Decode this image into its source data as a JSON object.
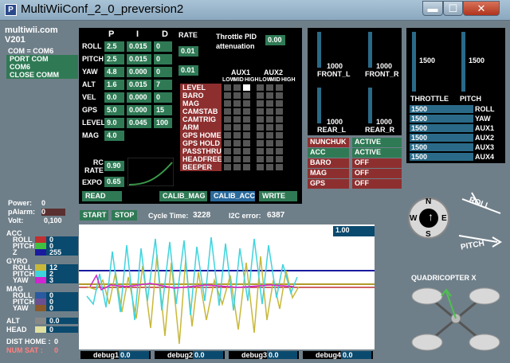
{
  "window": {
    "title": "MultiWiiConf_2_0_preversion2",
    "icon": "P",
    "min": "▬",
    "max": "☐",
    "close": "✕"
  },
  "site": "multiwii.com",
  "version": "V201",
  "com_status": "COM = COM6",
  "port": {
    "header": "PORT COM",
    "selected": "COM6",
    "close": "CLOSE COMM"
  },
  "pid": {
    "headers": {
      "p": "P",
      "i": "I",
      "d": "D",
      "rate": "RATE"
    },
    "rows": [
      {
        "name": "ROLL",
        "p": "2.5",
        "i": "0.015",
        "d": "0"
      },
      {
        "name": "PITCH",
        "p": "2.5",
        "i": "0.015",
        "d": "0"
      },
      {
        "name": "YAW",
        "p": "4.8",
        "i": "0.000",
        "d": "0"
      },
      {
        "name": "ALT",
        "p": "1.6",
        "i": "0.015",
        "d": "7"
      },
      {
        "name": "VEL",
        "p": "0.0",
        "i": "0.000",
        "d": "0"
      },
      {
        "name": "GPS",
        "p": "5.0",
        "i": "0.000",
        "d": "15"
      },
      {
        "name": "LEVEL",
        "p": "9.0",
        "i": "0.045",
        "d": "100"
      },
      {
        "name": "MAG",
        "p": "4.0",
        "i": "",
        "d": ""
      }
    ],
    "rates": [
      "0.01",
      "0.01"
    ],
    "throttle_pid": "Throttle PID\nattenuation",
    "throttle_pid_value": "0.00",
    "rc_rate_label": "RC\nRATE",
    "rc_rate": "0.90",
    "expo_label": "EXPO",
    "expo": "0.65"
  },
  "aux": {
    "aux1": "AUX1",
    "aux2": "AUX2",
    "sub": [
      "LOW",
      "MID",
      "HIGH",
      "LOW",
      "MID",
      "HIGH"
    ],
    "modes": [
      "LEVEL",
      "BARO",
      "MAG",
      "CAMSTAB",
      "CAMTRIG",
      "ARM",
      "GPS HOME",
      "GPS HOLD",
      "PASSTHRU",
      "HEADFREE",
      "BEEPER"
    ]
  },
  "buttons": {
    "read": "READ",
    "calib_mag": "CALIB_MAG",
    "calib_acc": "CALIB_ACC",
    "write": "WRITE",
    "start": "START",
    "stop": "STOP"
  },
  "rc": {
    "front_l": "FRONT_L",
    "front_r": "FRONT_R",
    "rear_l": "REAR_L",
    "rear_r": "REAR_R",
    "front_l_val": "1000",
    "front_r_val": "1000",
    "rear_l_val": "1000",
    "rear_r_val": "1000",
    "throttle": "THROTTLE",
    "throttle_val": "1500",
    "pitch": "PITCH",
    "pitch_val": "1500",
    "channels": [
      {
        "name": "ROLL",
        "val": "1500"
      },
      {
        "name": "YAW",
        "val": "1500"
      },
      {
        "name": "AUX1",
        "val": "1500"
      },
      {
        "name": "AUX2",
        "val": "1500"
      },
      {
        "name": "AUX3",
        "val": "1500"
      },
      {
        "name": "AUX4",
        "val": "1500"
      }
    ]
  },
  "sensors": [
    {
      "name": "NUNCHUK",
      "state": "ACTIVE"
    },
    {
      "name": "ACC",
      "state": "ACTIVE"
    },
    {
      "name": "BARO",
      "state": "OFF"
    },
    {
      "name": "MAG",
      "state": "OFF"
    },
    {
      "name": "GPS",
      "state": "OFF"
    }
  ],
  "power": {
    "power_label": "Power:",
    "power": "0",
    "palarm_label": "pAlarm:",
    "palarm": "0",
    "volt_label": "Volt:",
    "volt": "0,100"
  },
  "status": {
    "cycle_label": "Cycle Time:",
    "cycle": "3228",
    "i2c_label": "I2C error:",
    "i2c": "6387"
  },
  "graph": {
    "scale": "1.00"
  },
  "left_sensors": {
    "acc": {
      "title": "ACC",
      "roll": "ROLL",
      "roll_v": "0",
      "pitch": "PITCH",
      "pitch_v": "0",
      "z": "Z",
      "z_v": "255"
    },
    "gyro": {
      "title": "GYRO",
      "roll": "ROLL",
      "roll_v": "12",
      "pitch": "PITCH",
      "pitch_v": "2",
      "yaw": "YAW",
      "yaw_v": "3"
    },
    "mag": {
      "title": "MAG",
      "roll": "ROLL",
      "roll_v": "0",
      "pitch": "PITCH",
      "pitch_v": "0",
      "yaw": "YAW",
      "yaw_v": "0"
    },
    "alt": "ALT",
    "alt_v": "0.0",
    "head": "HEAD",
    "head_v": "0",
    "dist_home": "DIST HOME : ",
    "dist_home_v": "0",
    "num_sat": "NUM SAT  : ",
    "num_sat_v": "0"
  },
  "debug": [
    {
      "label": "debug1",
      "val": "0.0"
    },
    {
      "label": "debug2",
      "val": "0.0"
    },
    {
      "label": "debug3",
      "val": "0.0"
    },
    {
      "label": "debug4",
      "val": "0.0"
    }
  ],
  "attitude": {
    "roll": "ROLL",
    "pitch": "PITCH",
    "compass_n": "N",
    "compass_s": "S",
    "compass_e": "E",
    "compass_w": "W",
    "model": "QUADRICOPTER X"
  },
  "colors": {
    "accent": "#2f7a55",
    "panel": "#000000",
    "bg": "#6f7f89",
    "mode_label": "#8e2f2f"
  }
}
